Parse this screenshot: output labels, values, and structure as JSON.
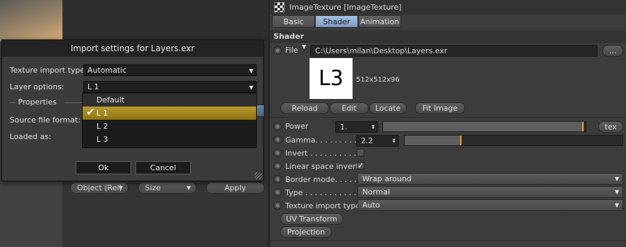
{
  "dialog": {
    "title": "Import settings for Layers.exr",
    "texture_import_type_label": "Texture import type:",
    "texture_import_type_value": "Automatic",
    "layer_options_label": "Layer options:",
    "layer_options_value": "L 1",
    "properties_label": "Properties",
    "source_file_format_label": "Source file format:",
    "loaded_as_label": "Loaded as:",
    "ok_label": "Ok",
    "cancel_label": "Cancel",
    "options": [
      "Default",
      "L 1",
      "L 2",
      "L 3"
    ],
    "selected_option": "L 1"
  },
  "midbar": {
    "object_label": "Object (Rel)",
    "size_label": "Size",
    "apply_label": "Apply"
  },
  "panel": {
    "title": "ImageTexture [ImageTexture]",
    "tabs": [
      "Basic",
      "Shader",
      "Animation"
    ],
    "active_tab": "Shader",
    "section": "Shader",
    "file_label": "File",
    "file_path": "C:\\Users\\milan\\Desktop\\Layers.exr",
    "browse_label": "...",
    "preview_text": "L3",
    "resolution": "512x512x96",
    "buttons": [
      "Reload",
      "Edit",
      "Locate",
      "Fit Image"
    ],
    "power_label": "Power",
    "power_value": "1.",
    "power_slider": 0.99,
    "tex_label": "tex",
    "gamma_label": "Gamma. . . . . . . . . .",
    "gamma_value": "2.2",
    "gamma_slider": 0.26,
    "invert_label": "Invert . . . . . . . . . .",
    "invert_checked": false,
    "linear_label": "Linear space invert",
    "linear_checked": true,
    "border_mode_label": "Border mode. . . . .",
    "border_mode_value": "Wrap around",
    "type_label": "Type . . . . . . . . . . .",
    "type_value": "Normal",
    "tex_import_label": "Texture import type",
    "tex_import_value": "Auto",
    "uv_transform_label": "UV Transform",
    "projection_label": "Projection",
    "accent_color": "#f0a020"
  }
}
